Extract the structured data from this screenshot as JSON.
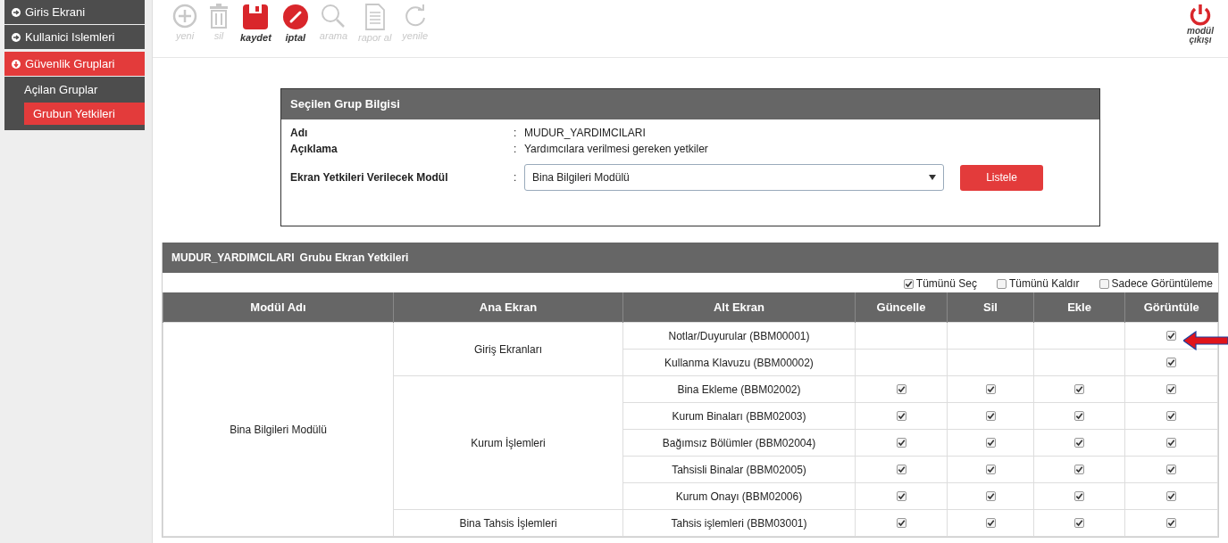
{
  "sidebar": {
    "items": [
      {
        "label": "Giris Ekrani",
        "expanded": false
      },
      {
        "label": "Kullanici Islemleri",
        "expanded": false
      },
      {
        "label": "Güvenlik Gruplari",
        "expanded": true,
        "children": [
          {
            "label": "Açilan Gruplar",
            "selected": false
          },
          {
            "label": "Grubun Yetkileri",
            "selected": true
          }
        ]
      }
    ]
  },
  "toolbar": {
    "buttons": [
      {
        "kind": "add",
        "label": "yeni",
        "disabled": true
      },
      {
        "kind": "delete",
        "label": "sil",
        "disabled": true
      },
      {
        "kind": "save",
        "label": "kaydet",
        "disabled": false
      },
      {
        "kind": "cancel",
        "label": "iptal",
        "disabled": false
      },
      {
        "kind": "search",
        "label": "arama",
        "disabled": true
      },
      {
        "kind": "report",
        "label": "rapor al",
        "disabled": true
      },
      {
        "kind": "refresh",
        "label": "yenile",
        "disabled": true
      }
    ],
    "exit": {
      "label": "modül çıkışı"
    }
  },
  "group_info": {
    "title": "Seçilen Grup Bilgisi",
    "fields": [
      {
        "label": "Adı",
        "separator": ":",
        "value": "MUDUR_YARDIMCILARI"
      },
      {
        "label": "Açıklama",
        "separator": ":",
        "value": "Yardımcılara verilmesi gereken yetkiler"
      }
    ],
    "module_select": {
      "label": "Ekran Yetkileri Verilecek Modül",
      "separator": ":",
      "value": "Bina Bilgileri Modülü"
    },
    "button": "Listele"
  },
  "permissions": {
    "title_group": "MUDUR_YARDIMCILARI",
    "title": "Grubu Ekran Yetkileri",
    "options": [
      {
        "label": "Tümünü Seç",
        "checked": true
      },
      {
        "label": "Tümünü Kaldır",
        "checked": false
      },
      {
        "label": "Sadece Görüntüleme",
        "checked": false
      }
    ],
    "columns": [
      "Modül Adı",
      "Ana Ekran",
      "Alt Ekran",
      "Güncelle",
      "Sil",
      "Ekle",
      "Görüntüle"
    ],
    "modules": [
      {
        "name": "Bina Bilgileri Modülü",
        "screens": [
          {
            "name": "Giriş Ekranları",
            "subs": [
              {
                "name": "Notlar/Duyurular (BBM00001)",
                "perms": [
                  {
                    "kind": "empty"
                  },
                  {
                    "kind": "empty"
                  },
                  {
                    "kind": "empty"
                  },
                  {
                    "kind": "checkbox",
                    "checked": true
                  }
                ]
              },
              {
                "name": "Kullanma Klavuzu (BBM00002)",
                "perms": [
                  {
                    "kind": "empty"
                  },
                  {
                    "kind": "empty"
                  },
                  {
                    "kind": "empty"
                  },
                  {
                    "kind": "checkbox",
                    "checked": true
                  }
                ]
              }
            ]
          },
          {
            "name": "Kurum İşlemleri",
            "subs": [
              {
                "name": "Bina Ekleme (BBM02002)",
                "perms": [
                  {
                    "kind": "checkbox",
                    "checked": true
                  },
                  {
                    "kind": "checkbox",
                    "checked": true
                  },
                  {
                    "kind": "checkbox",
                    "checked": true
                  },
                  {
                    "kind": "checkbox",
                    "checked": true
                  }
                ]
              },
              {
                "name": "Kurum Binaları (BBM02003)",
                "perms": [
                  {
                    "kind": "checkbox",
                    "checked": true
                  },
                  {
                    "kind": "checkbox",
                    "checked": true
                  },
                  {
                    "kind": "checkbox",
                    "checked": true
                  },
                  {
                    "kind": "checkbox",
                    "checked": true
                  }
                ]
              },
              {
                "name": "Bağımsız Bölümler (BBM02004)",
                "perms": [
                  {
                    "kind": "checkbox",
                    "checked": true
                  },
                  {
                    "kind": "checkbox",
                    "checked": true
                  },
                  {
                    "kind": "checkbox",
                    "checked": true
                  },
                  {
                    "kind": "checkbox",
                    "checked": true
                  }
                ]
              },
              {
                "name": "Tahsisli Binalar (BBM02005)",
                "perms": [
                  {
                    "kind": "checkbox",
                    "checked": true
                  },
                  {
                    "kind": "checkbox",
                    "checked": true
                  },
                  {
                    "kind": "checkbox",
                    "checked": true
                  },
                  {
                    "kind": "checkbox",
                    "checked": true
                  }
                ]
              },
              {
                "name": "Kurum Onayı (BBM02006)",
                "perms": [
                  {
                    "kind": "checkbox",
                    "checked": true
                  },
                  {
                    "kind": "checkbox",
                    "checked": true
                  },
                  {
                    "kind": "checkbox",
                    "checked": true
                  },
                  {
                    "kind": "checkbox",
                    "checked": true
                  }
                ]
              }
            ]
          },
          {
            "name": "Bina Tahsis İşlemleri",
            "subs": [
              {
                "name": "Tahsis işlemleri (BBM03001)",
                "perms": [
                  {
                    "kind": "checkbox",
                    "checked": true
                  },
                  {
                    "kind": "checkbox",
                    "checked": true
                  },
                  {
                    "kind": "checkbox",
                    "checked": true
                  },
                  {
                    "kind": "checkbox",
                    "checked": true
                  }
                ]
              }
            ]
          }
        ]
      }
    ]
  }
}
